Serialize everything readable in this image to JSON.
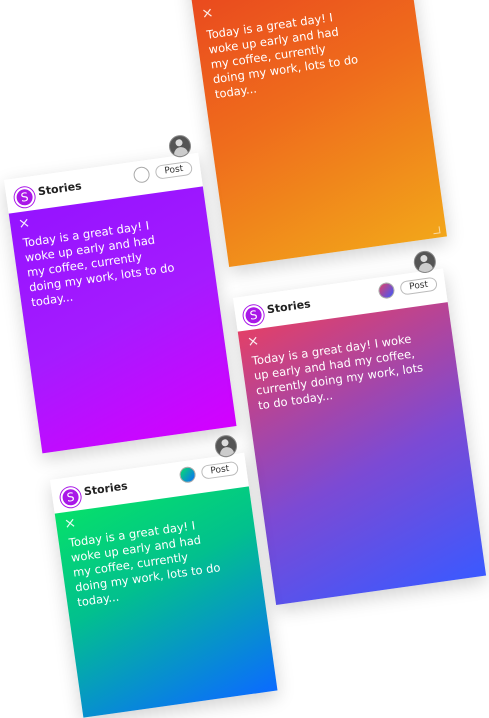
{
  "app": {
    "title": "Stories",
    "logo_letter": "S"
  },
  "story": {
    "close": "×",
    "text": "Today is a great day! I woke up early and had my coffee, currently doing my work, lots to do today...",
    "post_label": "Post"
  },
  "cards": [
    {
      "gradient": [
        "#e8411f",
        "#f2a61a"
      ]
    },
    {
      "gradient": [
        "#9c1cff",
        "#d100ff"
      ]
    },
    {
      "gradient": [
        "#e2406e",
        "#7d4bd3",
        "#3a5aff"
      ]
    },
    {
      "gradient": [
        "#06e06a",
        "#00a6c8",
        "#0b6bff"
      ]
    }
  ]
}
